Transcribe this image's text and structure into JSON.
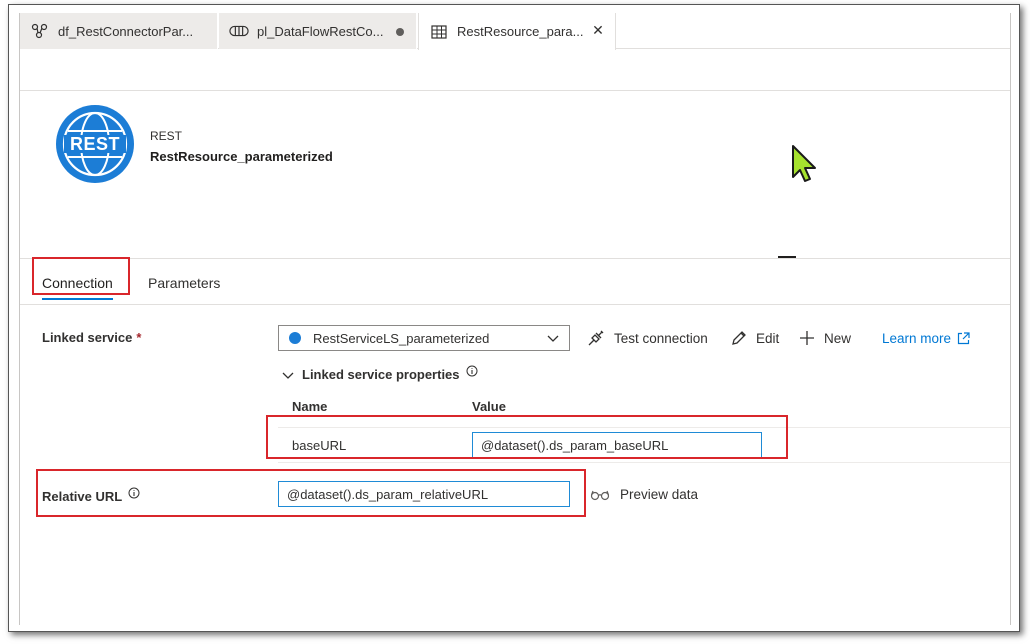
{
  "tabs": [
    {
      "label": "df_RestConnectorPar...",
      "icon": "dataflow-icon"
    },
    {
      "label": "pl_DataFlowRestCo...",
      "icon": "pipeline-icon",
      "modified": true
    },
    {
      "label": "RestResource_para...",
      "icon": "table-icon",
      "active": true
    }
  ],
  "header": {
    "logo_text": "REST",
    "type_label": "REST",
    "resource_name": "RestResource_parameterized"
  },
  "subtabs": [
    {
      "label": "Connection",
      "selected": true
    },
    {
      "label": "Parameters",
      "selected": false
    }
  ],
  "connection": {
    "linked_service_label": "Linked service",
    "required_mark": "*",
    "linked_service_value": "RestServiceLS_parameterized",
    "actions": {
      "test_connection": "Test connection",
      "edit": "Edit",
      "new": "New",
      "learn_more": "Learn more"
    },
    "properties_toggle": "Linked service properties",
    "columns": {
      "name": "Name",
      "value": "Value"
    },
    "properties": [
      {
        "name": "baseURL",
        "value": "@dataset().ds_param_baseURL"
      }
    ],
    "relative_url_label": "Relative URL",
    "relative_url_value": "@dataset().ds_param_relativeURL",
    "preview_data": "Preview data"
  },
  "colors": {
    "accent": "#0078d4",
    "highlight": "#d9262b",
    "rest_logo": "#1c7dd6",
    "cursor": "#a6e22e"
  }
}
